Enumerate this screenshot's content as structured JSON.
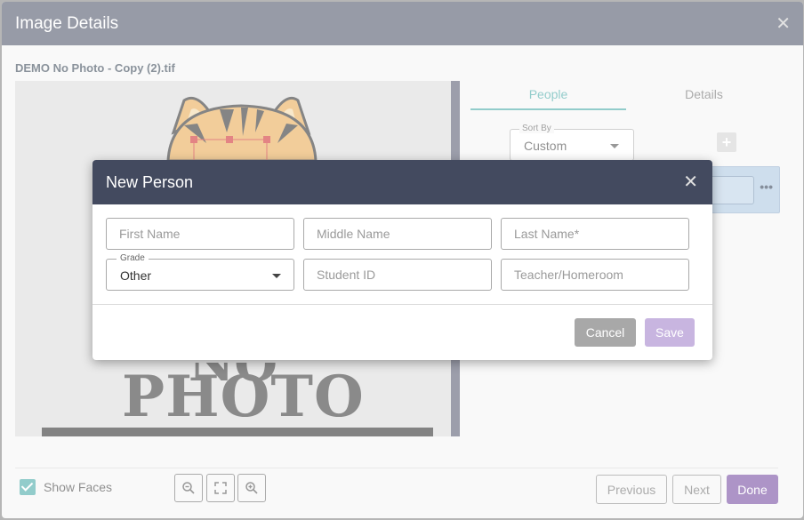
{
  "outer": {
    "title": "Image Details",
    "filename": "DEMO No Photo - Copy (2).tif",
    "image_text": {
      "line1": "NO",
      "line2": "PHOTO"
    },
    "tabs": [
      {
        "label": "People",
        "active": true
      },
      {
        "label": "Details",
        "active": false
      }
    ],
    "sort_by": {
      "label": "Sort By",
      "value": "Custom"
    },
    "show_faces": {
      "label": "Show Faces",
      "checked": true
    },
    "buttons": {
      "previous": "Previous",
      "next": "Next",
      "done": "Done"
    }
  },
  "modal": {
    "title": "New Person",
    "fields": {
      "first_name": {
        "placeholder": "First Name"
      },
      "middle_name": {
        "placeholder": "Middle Name"
      },
      "last_name": {
        "placeholder": "Last Name*"
      },
      "grade": {
        "label": "Grade",
        "value": "Other"
      },
      "student_id": {
        "placeholder": "Student ID"
      },
      "teacher": {
        "placeholder": "Teacher/Homeroom"
      }
    },
    "buttons": {
      "cancel": "Cancel",
      "save": "Save"
    }
  },
  "colors": {
    "header": "#434a5f",
    "accent_teal": "#3aa3a0",
    "done_purple": "#6a3d9a",
    "save_disabled": "#c8b5e0",
    "cancel_gray": "#a8a8a8"
  },
  "icons": [
    "close-icon",
    "chevron-down-icon",
    "plus-icon",
    "more-icon",
    "zoom-out-icon",
    "fit-screen-icon",
    "zoom-in-icon",
    "checkbox-checked-icon"
  ]
}
